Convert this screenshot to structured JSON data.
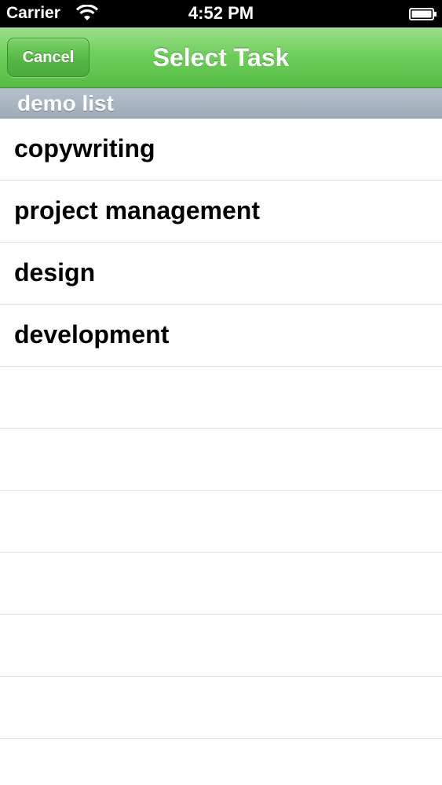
{
  "status_bar": {
    "carrier": "Carrier",
    "time": "4:52 PM",
    "icons": [
      "wifi-icon",
      "battery-icon"
    ]
  },
  "nav_bar": {
    "cancel_label": "Cancel",
    "title": "Select Task"
  },
  "section": {
    "header": "demo list",
    "items": [
      {
        "label": "copywriting"
      },
      {
        "label": "project management"
      },
      {
        "label": "design"
      },
      {
        "label": "development"
      }
    ]
  },
  "colors": {
    "nav_green": "#6fcf5c",
    "section_header": "#a8b4c0",
    "separator": "#e0e0e0"
  }
}
